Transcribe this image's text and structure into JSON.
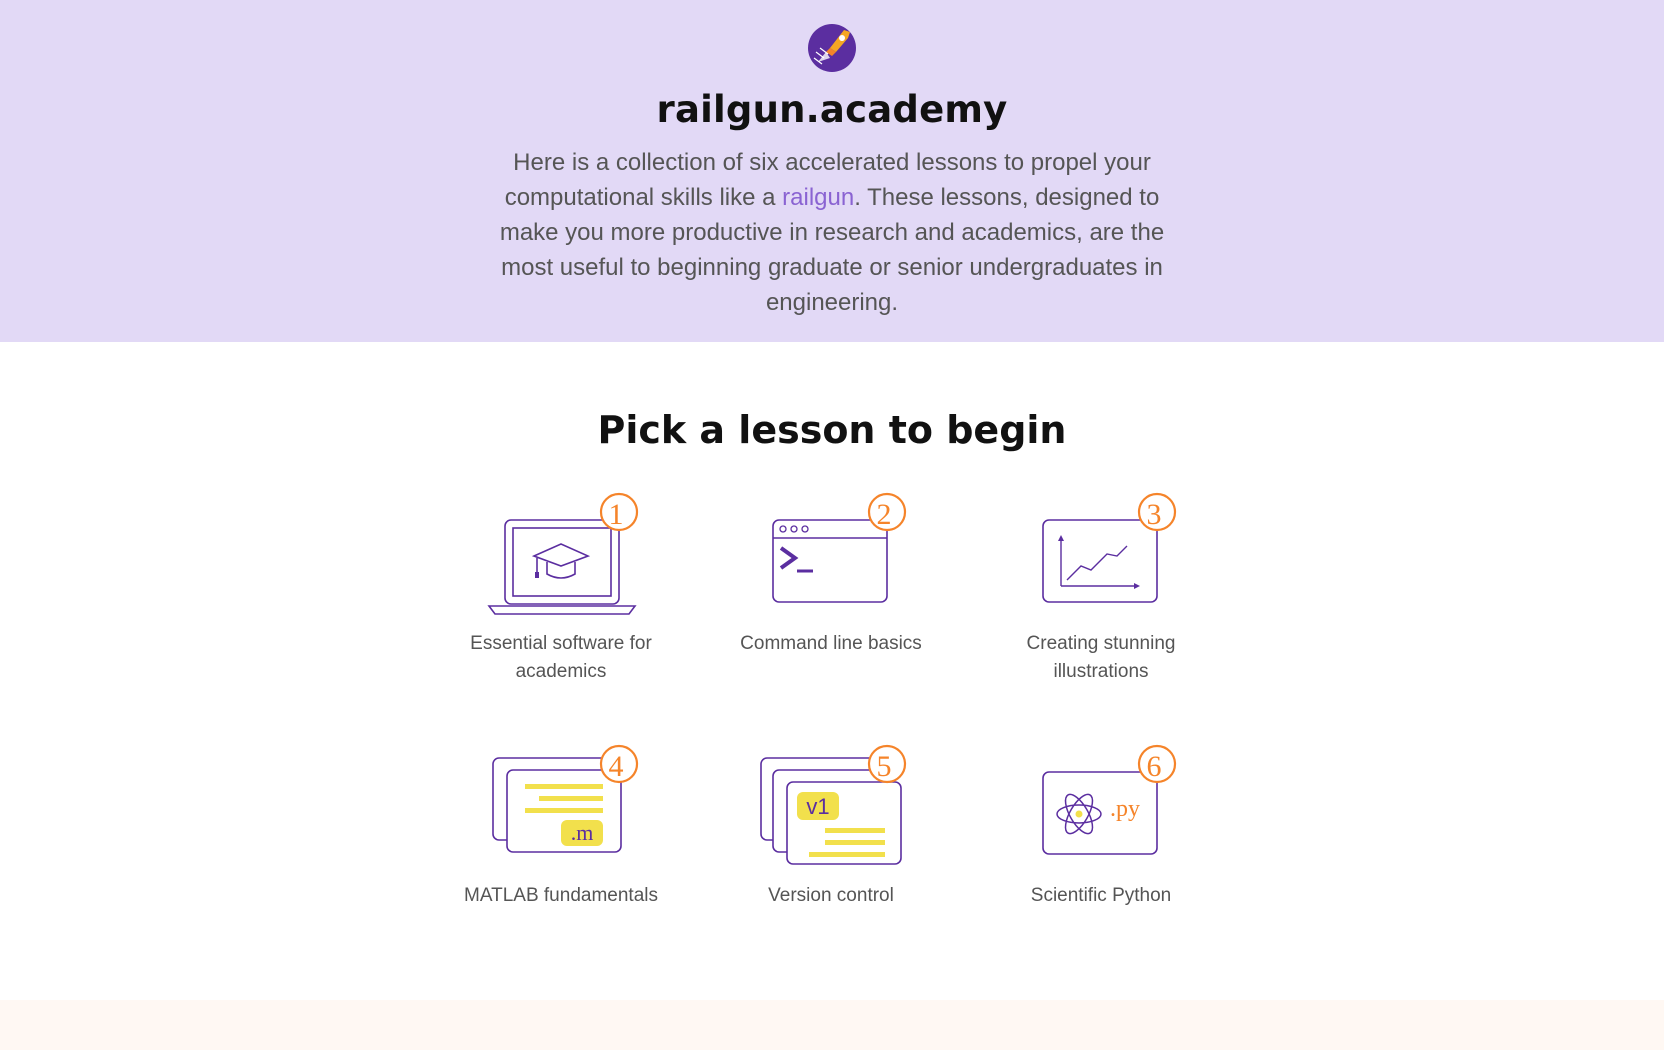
{
  "site": {
    "title": "railgun.academy",
    "intro_before": "Here is a collection of six accelerated lessons to propel your computational skills like a ",
    "intro_link": "railgun",
    "intro_after": ". These lessons, designed to make you more productive in research and academics, are the most useful to beginning graduate or senior undergraduates in engineering."
  },
  "lessons_section": {
    "title": "Pick a lesson to begin",
    "lessons": [
      {
        "number": "1",
        "label": "Essential software for academics",
        "icon": "laptop-graduation-cap-icon"
      },
      {
        "number": "2",
        "label": "Command line basics",
        "icon": "terminal-window-icon"
      },
      {
        "number": "3",
        "label": "Creating stunning illustrations",
        "icon": "line-chart-icon"
      },
      {
        "number": "4",
        "label": "MATLAB fundamentals",
        "icon": "matlab-files-icon",
        "badge": ".m"
      },
      {
        "number": "5",
        "label": "Version control",
        "icon": "stacked-versions-icon",
        "badge": "v1"
      },
      {
        "number": "6",
        "label": "Scientific Python",
        "icon": "atom-python-icon",
        "badge": ".py"
      }
    ]
  },
  "colors": {
    "hero_bg": "#e2d9f6",
    "accent_purple": "#5b2ea0",
    "accent_orange": "#f5842a",
    "accent_yellow": "#f2e04c",
    "link": "#8a63d2"
  }
}
